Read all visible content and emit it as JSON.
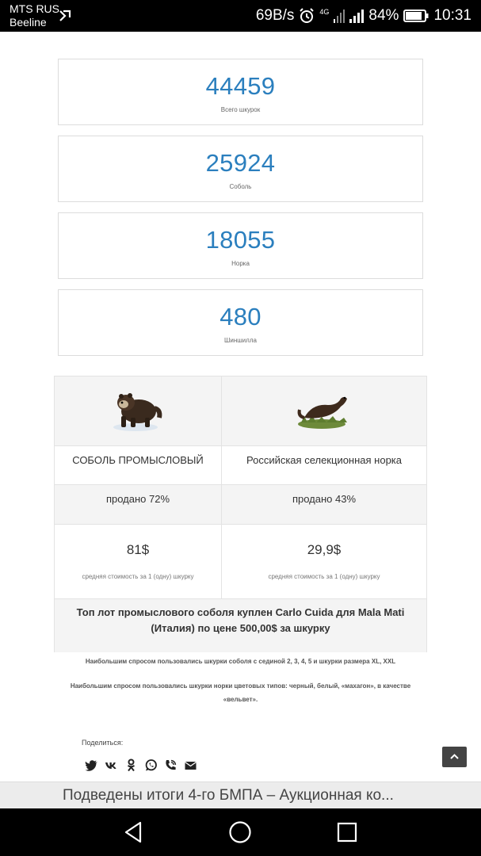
{
  "status_bar": {
    "carrier1": "MTS RUS",
    "carrier2": "Beeline",
    "speed": "69B/s",
    "network": "4G",
    "battery": "84%",
    "time": "10:31"
  },
  "stats": [
    {
      "number": "44459",
      "label": "Всего шкурок"
    },
    {
      "number": "25924",
      "label": "Соболь"
    },
    {
      "number": "18055",
      "label": "Норка"
    },
    {
      "number": "480",
      "label": "Шиншилла"
    }
  ],
  "comparison": {
    "left": {
      "name": "СОБОЛЬ ПРОМЫСЛОВЫЙ",
      "sold": "продано 72%",
      "price": "81$",
      "cost_note": "средняя стоимость за 1 (одну) шкурку",
      "image_icon": "sable-icon"
    },
    "right": {
      "name": "Российская селекционная норка",
      "sold": "продано 43%",
      "price": "29,9$",
      "cost_note": "средняя стоимость за 1 (одну) шкурку",
      "image_icon": "mink-icon"
    },
    "top_lot": "Топ лот промыслового соболя куплен Carlo Cuida для Mala Mati (Италия)  по цене 500,00$ за шкурку"
  },
  "notes": [
    "Наибольшим спросом пользовались шкурки соболя с сединой 2, 3, 4, 5 и шкурки размера XL, XXL",
    "Наибольшим спросом пользовались шкурки норки цветовых типов: черный, белый, «махагон», в качестве «вельвет»."
  ],
  "share": {
    "label": "Поделиться:",
    "icons": [
      "twitter-icon",
      "vk-icon",
      "odnoklassniki-icon",
      "whatsapp-icon",
      "viber-icon",
      "email-icon"
    ]
  },
  "ticker_text": "Подведены итоги 4-го БМПА – Аукционная ко...",
  "colors": {
    "accent": "#2b7fbe",
    "table_bg": "#f4f4f4"
  }
}
